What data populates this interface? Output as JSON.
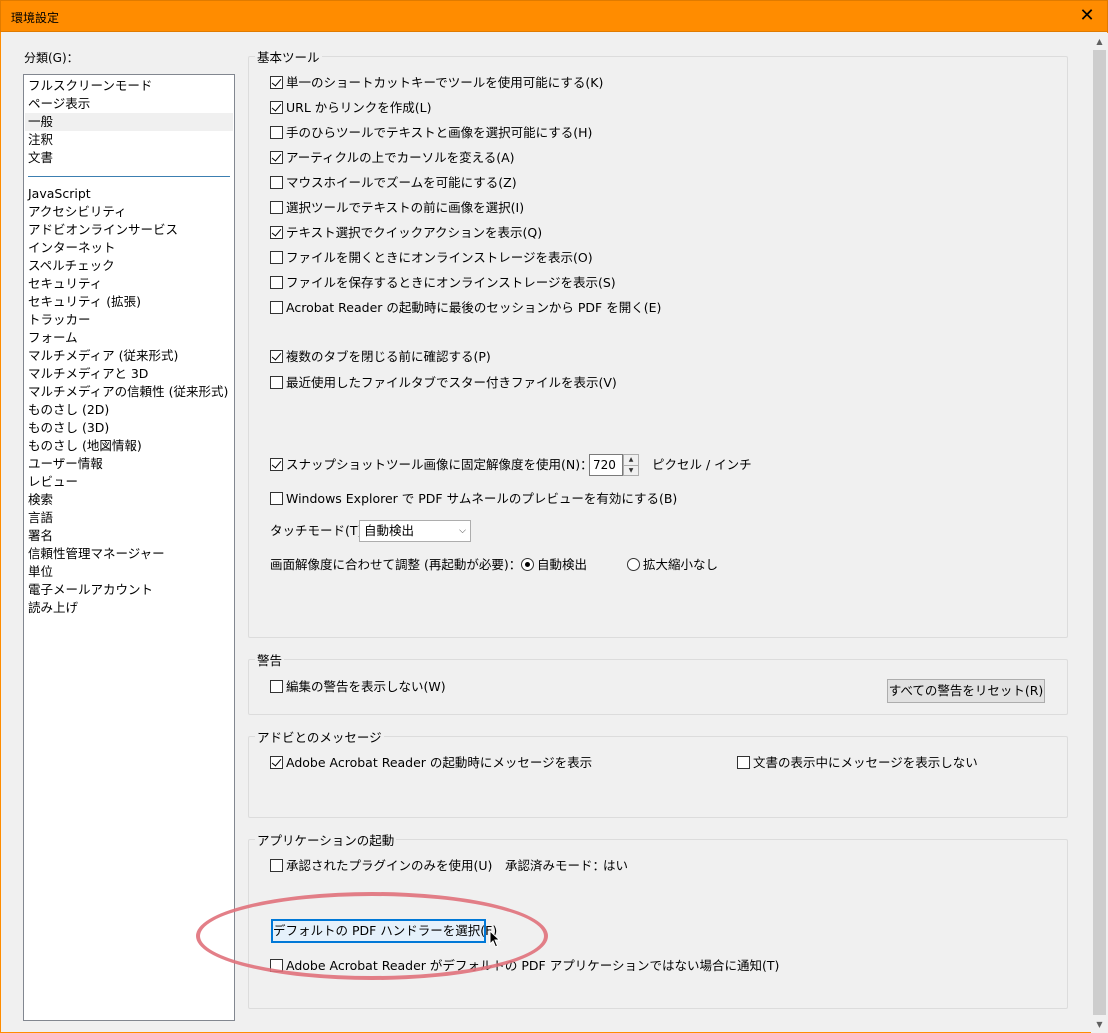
{
  "window": {
    "title": "環境設定",
    "close": "✕"
  },
  "categories": {
    "label": "分類(G)：",
    "group1": [
      "フルスクリーンモード",
      "ページ表示",
      "一般",
      "注釈",
      "文書"
    ],
    "group2": [
      "JavaScript",
      "アクセシビリティ",
      "アドビオンラインサービス",
      "インターネット",
      "スペルチェック",
      "セキュリティ",
      "セキュリティ (拡張)",
      "トラッカー",
      "フォーム",
      "マルチメディア (従来形式)",
      "マルチメディアと 3D",
      "マルチメディアの信頼性 (従来形式)",
      "ものさし (2D)",
      "ものさし (3D)",
      "ものさし (地図情報)",
      "ユーザー情報",
      "レビュー",
      "検索",
      "言語",
      "署名",
      "信頼性管理マネージャー",
      "単位",
      "電子メールアカウント",
      "読み上げ"
    ],
    "selected": "一般"
  },
  "basic": {
    "legend": "基本ツール",
    "items": [
      {
        "label": "単一のショートカットキーでツールを使用可能にする(K)",
        "checked": true
      },
      {
        "label": "URL からリンクを作成(L)",
        "checked": true
      },
      {
        "label": "手のひらツールでテキストと画像を選択可能にする(H)",
        "checked": false
      },
      {
        "label": "アーティクルの上でカーソルを変える(A)",
        "checked": true
      },
      {
        "label": "マウスホイールでズームを可能にする(Z)",
        "checked": false
      },
      {
        "label": "選択ツールでテキストの前に画像を選択(I)",
        "checked": false
      },
      {
        "label": "テキスト選択でクイックアクションを表示(Q)",
        "checked": true
      },
      {
        "label": "ファイルを開くときにオンラインストレージを表示(O)",
        "checked": false
      },
      {
        "label": "ファイルを保存するときにオンラインストレージを表示(S)",
        "checked": false
      },
      {
        "label": "Acrobat Reader の起動時に最後のセッションから PDF を開く(E)",
        "checked": false
      }
    ],
    "tabs": [
      {
        "label": "複数のタブを閉じる前に確認する(P)",
        "checked": true
      },
      {
        "label": "最近使用したファイルタブでスター付きファイルを表示(V)",
        "checked": false
      }
    ],
    "snapshot": {
      "label": "スナップショットツール画像に固定解像度を使用(N)：",
      "checked": true,
      "value": "720",
      "unit": "ピクセル / インチ"
    },
    "thumbnail": {
      "label": "Windows Explorer で PDF サムネールのプレビューを有効にする(B)",
      "checked": false
    },
    "touch": {
      "label": "タッチモード(T)：",
      "value": "自動検出"
    },
    "resolution": {
      "label": "画面解像度に合わせて調整 (再起動が必要)：",
      "opt1": "自動検出",
      "opt2": "拡大縮小なし",
      "selected": "自動検出"
    }
  },
  "warnings": {
    "legend": "警告",
    "edit_warn": {
      "label": "編集の警告を表示しない(W)",
      "checked": false
    },
    "reset_button": "すべての警告をリセット(R)"
  },
  "messages": {
    "legend": "アドビとのメッセージ",
    "launch": {
      "label": "Adobe Acrobat Reader の起動時にメッセージを表示",
      "checked": true
    },
    "viewing": {
      "label": "文書の表示中にメッセージを表示しない",
      "checked": false
    }
  },
  "startup": {
    "legend": "アプリケーションの起動",
    "plugins": {
      "label": "承認されたプラグインのみを使用(U)",
      "checked": false
    },
    "certified_label": "承認済みモード：",
    "certified_value": "はい",
    "default_handler_button": "デフォルトの PDF ハンドラーを選択(F)",
    "notify": {
      "label": "Adobe Acrobat Reader がデフォルトの PDF アプリケーションではない場合に通知(T)",
      "checked": false
    }
  },
  "colors": {
    "titlebar": "#ff8c00",
    "annotation": "#e0717b",
    "focus": "#0078d7"
  }
}
